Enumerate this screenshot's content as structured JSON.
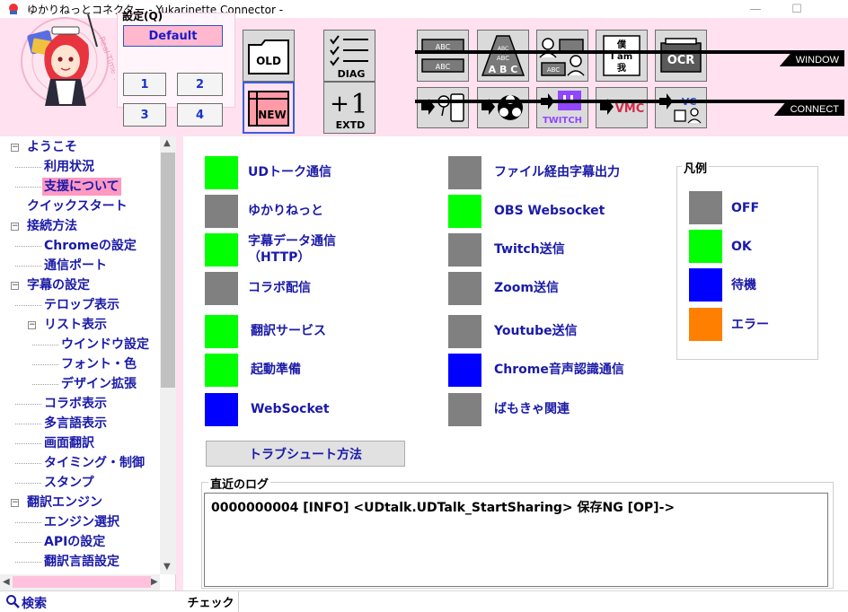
{
  "window": {
    "title": "ゆかりねっとコネクター - Yukarinette Connector -",
    "controls": {
      "minimize": "—",
      "maximize": "☐"
    }
  },
  "toolbar": {
    "logo_text": "Real-Time Translation Tool",
    "preset": {
      "label": "設定(Q)",
      "default_label": "Default",
      "buttons": [
        "1",
        "2",
        "3",
        "4"
      ]
    },
    "buttons": {
      "old": "OLD",
      "new": "NEW",
      "diag": "DIAG",
      "extd": "EXTD",
      "ocr": "OCR",
      "twitch": "TWITCH",
      "vmc": "VMC",
      "vc": "VC",
      "abc": "ABC",
      "abc_big": "A B C",
      "iam_lines": [
        "僕",
        "I am",
        "我"
      ]
    },
    "bars": {
      "window": "WINDOW",
      "connect": "CONNECT"
    }
  },
  "tree": {
    "items": [
      {
        "label": "ようこそ",
        "level": 0
      },
      {
        "label": "利用状況",
        "level": 1
      },
      {
        "label": "支援について",
        "level": 1,
        "selected": true
      },
      {
        "label": "クイックスタート",
        "level": 0
      },
      {
        "label": "接続方法",
        "level": 0
      },
      {
        "label": "Chromeの設定",
        "level": 1
      },
      {
        "label": "通信ポート",
        "level": 1
      },
      {
        "label": "字幕の設定",
        "level": 0
      },
      {
        "label": "テロップ表示",
        "level": 1
      },
      {
        "label": "リスト表示",
        "level": 1
      },
      {
        "label": "ウインドウ設定",
        "level": 2
      },
      {
        "label": "フォント・色",
        "level": 2
      },
      {
        "label": "デザイン拡張",
        "level": 2
      },
      {
        "label": "コラボ表示",
        "level": 1
      },
      {
        "label": "多言語表示",
        "level": 1
      },
      {
        "label": "画面翻訳",
        "level": 1
      },
      {
        "label": "タイミング・制御",
        "level": 1
      },
      {
        "label": "スタンプ",
        "level": 1
      },
      {
        "label": "翻訳エンジン",
        "level": 0
      },
      {
        "label": "エンジン選択",
        "level": 1
      },
      {
        "label": "APIの設定",
        "level": 1
      },
      {
        "label": "翻訳言語設定",
        "level": 1
      }
    ],
    "search_label": "検索"
  },
  "status": {
    "left": [
      {
        "label": "UDトーク通信",
        "color": "#00ff00"
      },
      {
        "label": "ゆかりねっと",
        "color": "#808080"
      },
      {
        "label": "字幕データ通信\n（HTTP）",
        "color": "#00ff00"
      },
      {
        "label": "コラボ配信",
        "color": "#808080"
      },
      {
        "label": "翻訳サービス",
        "color": "#00ff00"
      },
      {
        "label": "起動準備",
        "color": "#00ff00"
      },
      {
        "label": "WebSocket",
        "color": "#0000ff"
      }
    ],
    "right": [
      {
        "label": "ファイル経由字幕出力",
        "color": "#808080"
      },
      {
        "label": "OBS Websocket",
        "color": "#00ff00"
      },
      {
        "label": "Twitch送信",
        "color": "#808080"
      },
      {
        "label": "Zoom送信",
        "color": "#808080"
      },
      {
        "label": "Youtube送信",
        "color": "#808080"
      },
      {
        "label": "Chrome音声認識通信",
        "color": "#0000ff"
      },
      {
        "label": "ばもきゃ関連",
        "color": "#808080"
      }
    ]
  },
  "legend": {
    "title": "凡例",
    "items": [
      {
        "label": "OFF",
        "color": "#808080"
      },
      {
        "label": "OK",
        "color": "#00ff00"
      },
      {
        "label": "待機",
        "color": "#0000ff"
      },
      {
        "label": "エラー",
        "color": "#ff8000"
      }
    ]
  },
  "troubleshoot_label": "トラブシュート方法",
  "log": {
    "title": "直近のログ",
    "line": "0000000004  [INFO] <UDtalk.UDTalk_StartSharing> 保存NG  [OP]->"
  },
  "bottom_tab": "チェック",
  "colors": {
    "accent_pink": "#ffe1ef",
    "label_blue": "#1a1aa8"
  }
}
